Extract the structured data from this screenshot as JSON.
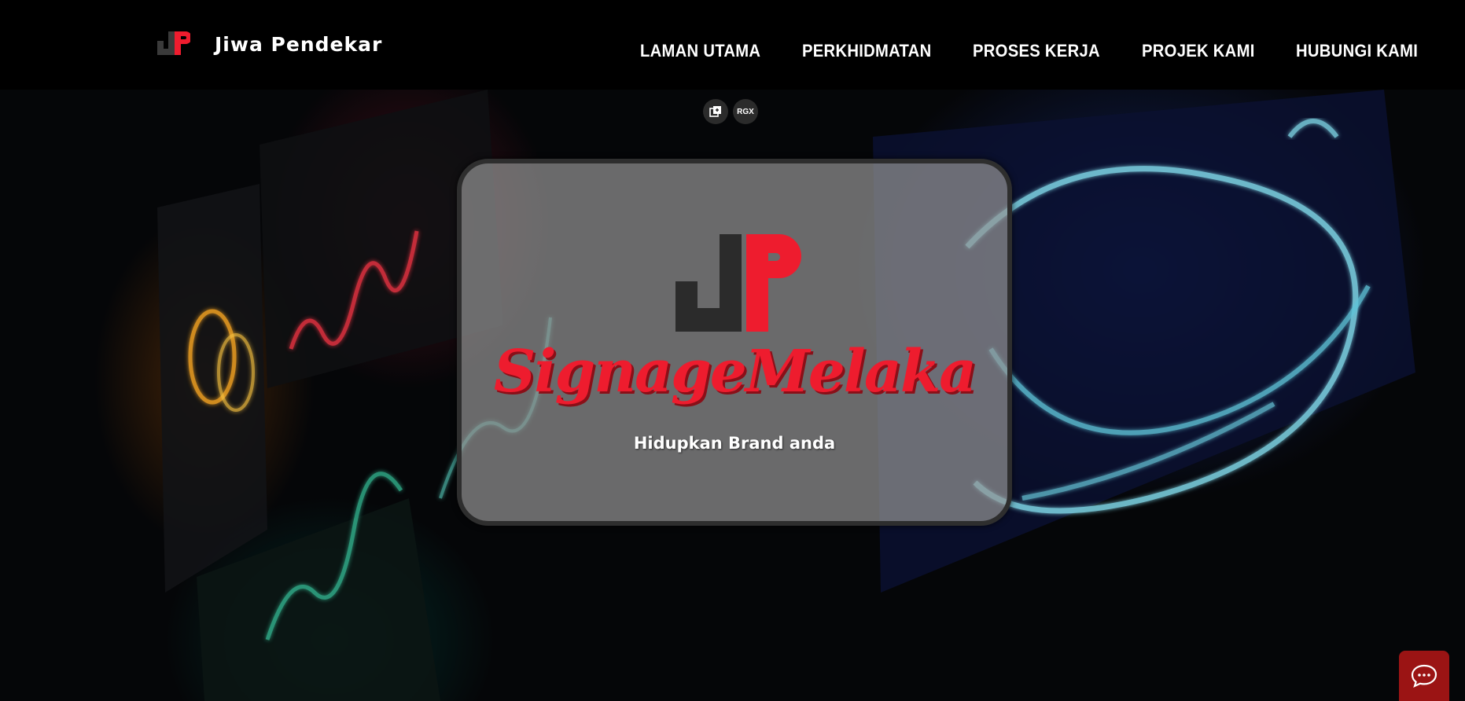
{
  "header": {
    "brand_name": "Jiwa Pendekar",
    "logo_icon": "jp-logo-icon"
  },
  "nav": {
    "items": [
      {
        "label": "LAMAN UTAMA"
      },
      {
        "label": "PERKHIDMATAN"
      },
      {
        "label": "PROSES KERJA"
      },
      {
        "label": "PROJEK KAMI"
      },
      {
        "label": "HUBUNGI KAMI"
      }
    ]
  },
  "toolbar": {
    "copy_icon": "copy-icon",
    "rgx_label": "RGX"
  },
  "hero": {
    "title": "SignageMelaka",
    "subtitle": "Hidupkan Brand anda"
  },
  "chat": {
    "icon": "chat-bubble-icon"
  },
  "colors": {
    "brand_red": "#ee1c2e",
    "logo_dark": "#2b2b2b",
    "chat_red": "#9b1414"
  }
}
